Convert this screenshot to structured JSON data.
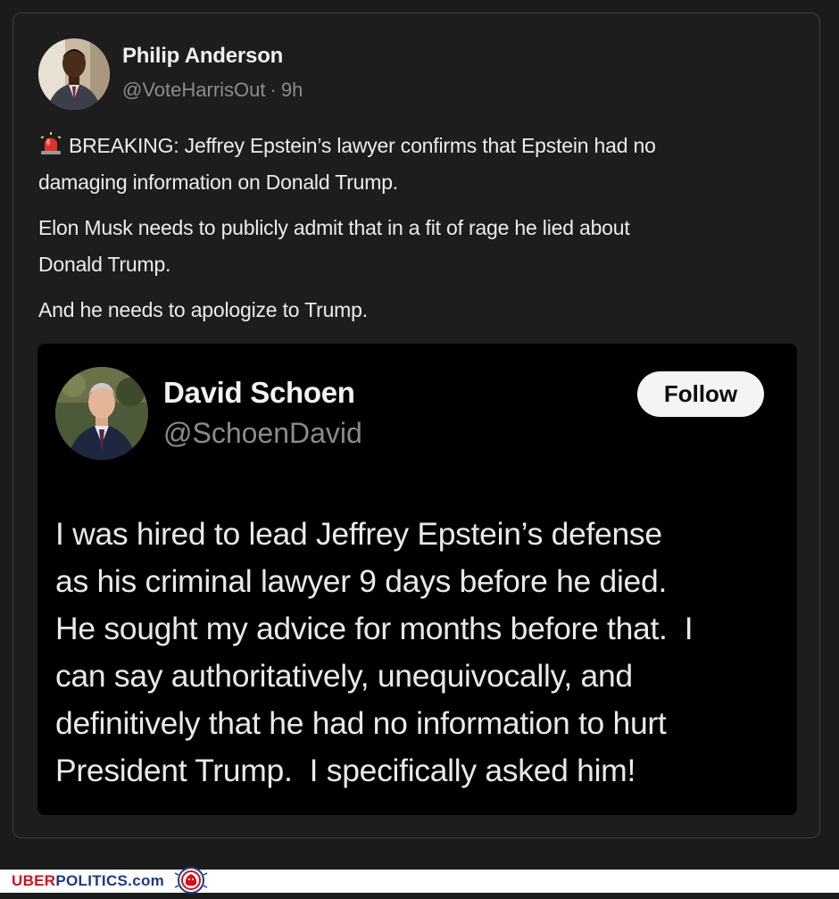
{
  "post": {
    "author_name": "Philip Anderson",
    "author_handle": "@VoteHarrisOut",
    "separator": "·",
    "time_ago": "9h",
    "paragraphs": [
      "BREAKING: Jeffrey Epstein’s lawyer confirms that Epstein had no damaging information on Donald Trump.",
      "Elon Musk needs to publicly admit that in a fit of rage he lied about Donald Trump.",
      "And he needs to apologize to Trump."
    ],
    "p1_line1": "BREAKING: Jeffrey Epstein’s lawyer confirms that Epstein had no",
    "p1_line2": "damaging information on Donald Trump.",
    "p2_line1": "Elon Musk needs to publicly admit that in a fit of rage he lied about",
    "p2_line2": "Donald Trump.",
    "p3_line1": "And he needs to apologize to Trump.",
    "lead_icon": "siren-icon"
  },
  "embed": {
    "author_name": "David Schoen",
    "author_handle": "@SchoenDavid",
    "follow_label": "Follow",
    "text_lines": [
      "I was hired to lead Jeffrey Epstein’s defense",
      "as his criminal lawyer 9 days before he died.",
      "He sought my advice for months before that.  I",
      "can say authoritatively, unequivocally, and",
      "definitively that he had no information to hurt",
      "President Trump.  I specifically asked him!"
    ]
  },
  "watermark": {
    "part1": "UBER",
    "part2": "POLITICS",
    "part3": ".com",
    "logo_icon": "lion-seal-icon",
    "colors": {
      "red": "#d0121b",
      "blue": "#1b3a8c"
    }
  },
  "colors": {
    "background": "#1b1b1b",
    "card_border": "#3f3f3f",
    "embed_background": "#000000",
    "primary_text": "#ececec",
    "secondary_text": "#8c8c8c",
    "follow_button_bg": "#f4f4f4"
  }
}
